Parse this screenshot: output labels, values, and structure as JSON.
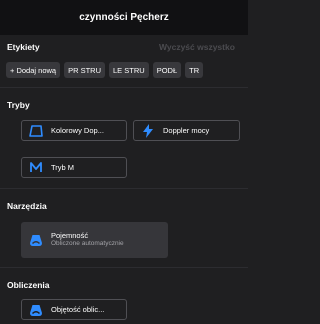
{
  "header": {
    "title": "czynności Pęcherz"
  },
  "labels": {
    "title": "Etykiety",
    "clear_all": "Wyczyść wszystko",
    "chips": [
      "+ Dodaj nową",
      "PR STRU",
      "LE STRU",
      "PODŁ",
      "TR"
    ]
  },
  "modes": {
    "title": "Tryby",
    "items": [
      {
        "label": "Kolorowy Dop...",
        "icon": "color-doppler-icon"
      },
      {
        "label": "Doppler mocy",
        "icon": "lightning-icon"
      },
      {
        "label": "Tryb M",
        "icon": "m-mode-icon"
      }
    ]
  },
  "tools": {
    "title": "Narzędzia",
    "items": [
      {
        "label": "Pojemność",
        "sublabel": "Obliczone automatycznie",
        "icon": "bladder-icon"
      }
    ]
  },
  "calculations": {
    "title": "Obliczenia",
    "items": [
      {
        "label": "Objętość oblic...",
        "icon": "bladder-icon"
      }
    ]
  },
  "colors": {
    "accent": "#2f8cff",
    "background": "#1f1f21",
    "header": "#111113"
  }
}
